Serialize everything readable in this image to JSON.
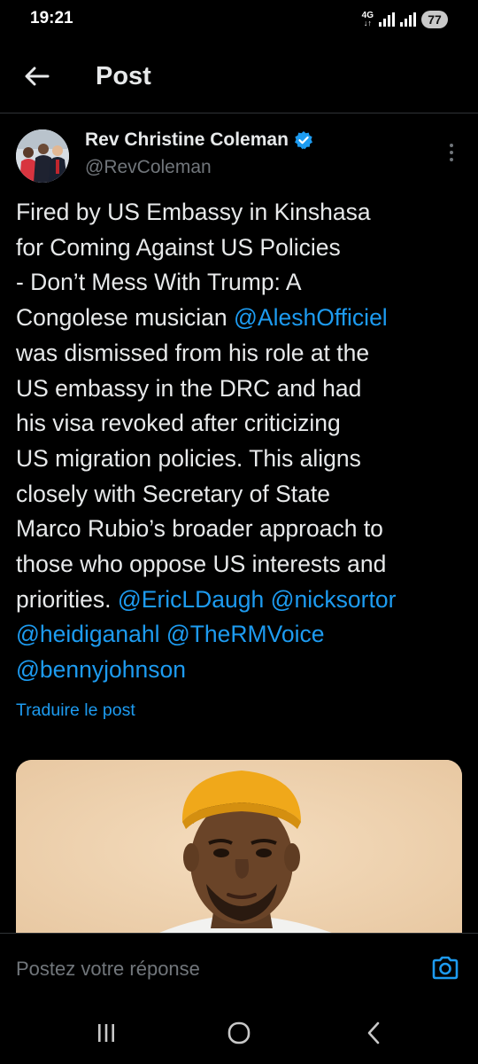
{
  "status_bar": {
    "time": "19:21",
    "network_label": "4G",
    "battery_level": "77"
  },
  "header": {
    "title": "Post",
    "back_icon": "arrow-left-icon"
  },
  "post": {
    "author": {
      "name": "Rev Christine Coleman",
      "handle": "@RevColeman",
      "verified": true
    },
    "text_lines": [
      [
        {
          "t": "Fired by US Embassy in Kinshasa",
          "m": false
        }
      ],
      [
        {
          "t": "for Coming Against US Policies",
          "m": false
        }
      ],
      [
        {
          "t": "- Don’t Mess With Trump: A",
          "m": false
        }
      ],
      [
        {
          "t": "Congolese musician ",
          "m": false
        },
        {
          "t": "@AleshOfficiel",
          "m": true
        }
      ],
      [
        {
          "t": "was dismissed from his role at the",
          "m": false
        }
      ],
      [
        {
          "t": "US embassy in the DRC and had",
          "m": false
        }
      ],
      [
        {
          "t": "his visa revoked after criticizing",
          "m": false
        }
      ],
      [
        {
          "t": "US migration policies. This aligns",
          "m": false
        }
      ],
      [
        {
          "t": "closely with Secretary of State",
          "m": false
        }
      ],
      [
        {
          "t": "Marco Rubio’s broader approach to",
          "m": false
        }
      ],
      [
        {
          "t": "those who oppose US interests and",
          "m": false
        }
      ],
      [
        {
          "t": "priorities. ",
          "m": false
        },
        {
          "t": "@EricLDaugh",
          "m": true
        },
        {
          "t": " ",
          "m": false
        },
        {
          "t": "@nicksortor",
          "m": true
        }
      ],
      [
        {
          "t": "@heidiganahl",
          "m": true
        },
        {
          "t": " ",
          "m": false
        },
        {
          "t": "@TheRMVoice",
          "m": true
        }
      ],
      [
        {
          "t": "@bennyjohnson",
          "m": true
        }
      ]
    ],
    "translate_label": "Traduire le post"
  },
  "reply": {
    "placeholder": "Postez votre réponse"
  },
  "colors": {
    "background": "#000000",
    "text": "#e7e9ea",
    "secondary_text": "#71767b",
    "accent": "#1d9bf0",
    "divider": "#2f3336"
  }
}
